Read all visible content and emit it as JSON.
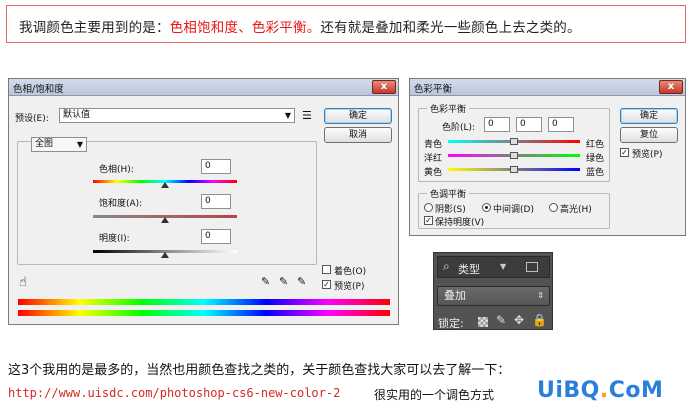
{
  "banner": {
    "text_pre": "我调颜色主要用到的是：",
    "text_hl": "色相饱和度、色彩平衡。",
    "text_post": "还有就是叠加和柔光一些颜色上去之类的。",
    "hl_color": "#e81717"
  },
  "hsl_dialog": {
    "title": "色相/饱和度",
    "close": "x",
    "preset_label": "预设(E):",
    "preset_value": "默认值",
    "preset_menu_icon": "list-icon",
    "ok": "确定",
    "cancel": "取消",
    "channel": "全图",
    "hue_label": "色相(H):",
    "hue_value": "0",
    "sat_label": "饱和度(A):",
    "sat_value": "0",
    "light_label": "明度(I):",
    "light_value": "0",
    "colorize_label": "着色(O)",
    "preview_label": "预览(P)",
    "preview_checked": "✓"
  },
  "balance_dialog": {
    "title": "色彩平衡",
    "close": "x",
    "group_balance": "色彩平衡",
    "levels_label": "色阶(L):",
    "level1": "0",
    "level2": "0",
    "level3": "0",
    "cyan": "青色",
    "red": "红色",
    "magenta": "洋红",
    "green": "绿色",
    "yellow": "黄色",
    "blue": "蓝色",
    "group_tone": "色调平衡",
    "shadows": "阴影(S)",
    "midtones": "中间调(D)",
    "highlights": "高光(H)",
    "preserve": "保持明度(V)",
    "ok": "确定",
    "reset": "复位",
    "preview": "预览(P)",
    "checked": "✓"
  },
  "ps_panel": {
    "filter_icon": "search-icon",
    "filter_label": "类型",
    "blend_mode": "叠加",
    "lock_label": "锁定:"
  },
  "para": "这3个我用的是最多的，当然也用颜色查找之类的，关于颜色查找大家可以去了解一下：",
  "url": "http://www.uisdc.com/photoshop-cs6-new-color-2",
  "url_tail": "很实用的一个调色方式",
  "logo": {
    "a": "UiBQ",
    "b": ".",
    "c": "CoM"
  }
}
